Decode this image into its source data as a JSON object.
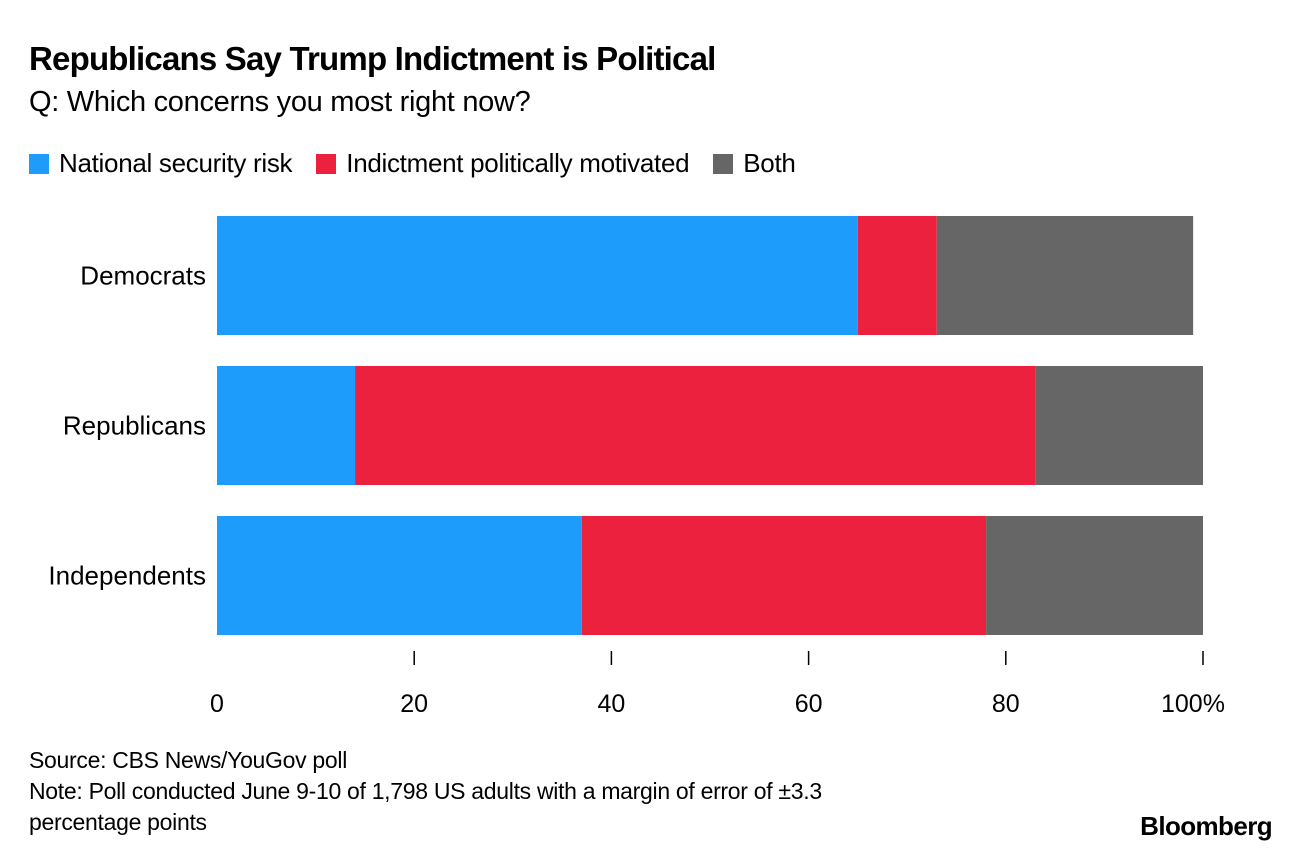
{
  "chart_data": {
    "type": "bar",
    "orientation": "horizontal",
    "stacked": true,
    "title": "Republicans Say Trump Indictment is Political",
    "subtitle": "Q: Which concerns you most right now?",
    "categories": [
      "Democrats",
      "Republicans",
      "Independents"
    ],
    "series": [
      {
        "name": "National security risk",
        "color": "#1E9CFB",
        "values": [
          65,
          14,
          37
        ]
      },
      {
        "name": "Indictment politically motivated",
        "color": "#EC213E",
        "values": [
          8,
          69,
          41
        ]
      },
      {
        "name": "Both",
        "color": "#666666",
        "values": [
          26,
          17,
          22
        ]
      }
    ],
    "xlabel": "",
    "ylabel": "",
    "xlim": [
      0,
      100
    ],
    "x_ticks": [
      0,
      20,
      40,
      60,
      80,
      100
    ],
    "x_tick_labels": [
      "0",
      "20",
      "40",
      "60",
      "80",
      "100%"
    ],
    "grid": false,
    "legend_position": "top-left"
  },
  "footer": {
    "source": "Source: CBS News/YouGov poll",
    "note_line1": "Note: Poll conducted June 9-10 of 1,798 US adults with a margin of error of ±3.3",
    "note_line2": "percentage points"
  },
  "brand": "Bloomberg"
}
